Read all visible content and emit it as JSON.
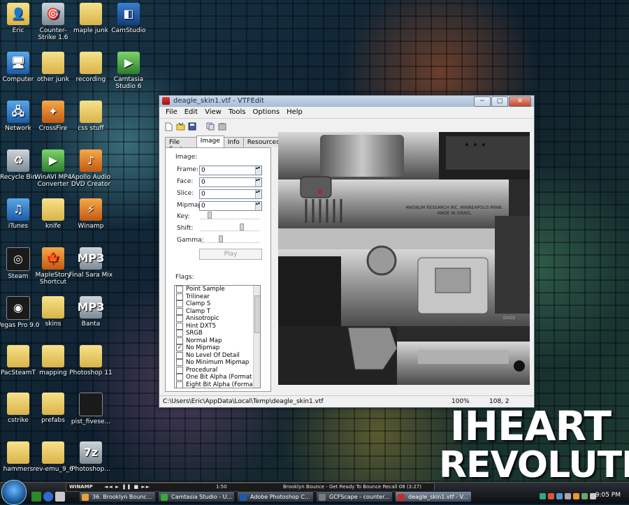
{
  "desktop": {
    "icons": [
      {
        "label": "Eric",
        "glyph": "👤",
        "style": "folder"
      },
      {
        "label": "Counter-Strike 1.6",
        "glyph": "🎯",
        "style": "grey"
      },
      {
        "label": "maple junk",
        "glyph": "",
        "style": "folder"
      },
      {
        "label": "CamStudio",
        "glyph": "◧",
        "style": "teal"
      },
      {
        "label": "Computer",
        "glyph": "🖥",
        "style": "blue"
      },
      {
        "label": "other junk",
        "glyph": "",
        "style": "folder"
      },
      {
        "label": "recording",
        "glyph": "",
        "style": "folder"
      },
      {
        "label": "Camtasia Studio 6",
        "glyph": "▶",
        "style": "green"
      },
      {
        "label": "Network",
        "glyph": "🖧",
        "style": "blue"
      },
      {
        "label": "CrossFire",
        "glyph": "✦",
        "style": "orange"
      },
      {
        "label": "css stuff",
        "glyph": "",
        "style": "folder"
      },
      {
        "label": "Recycle Bin",
        "glyph": "♻",
        "style": "grey"
      },
      {
        "label": "WinAVI MP4 Converter",
        "glyph": "▶",
        "style": "green"
      },
      {
        "label": "Apollo Audio DVD Creator",
        "glyph": "♪",
        "style": "orange"
      },
      {
        "label": "iTunes",
        "glyph": "♫",
        "style": "blue"
      },
      {
        "label": "knife",
        "glyph": "",
        "style": "folder"
      },
      {
        "label": "Winamp",
        "glyph": "⚡",
        "style": "orange"
      },
      {
        "label": "Steam",
        "glyph": "◎",
        "style": "dark"
      },
      {
        "label": "MapleStory Shortcut",
        "glyph": "🍁",
        "style": "orange"
      },
      {
        "label": "Final Sara Mix",
        "glyph": "MP3",
        "style": "grey"
      },
      {
        "label": "Vegas Pro 9.0",
        "glyph": "◉",
        "style": "dark"
      },
      {
        "label": "skins",
        "glyph": "",
        "style": "folder"
      },
      {
        "label": "Banta",
        "glyph": "MP3",
        "style": "grey"
      },
      {
        "label": "PacSteamT",
        "glyph": "",
        "style": "folder"
      },
      {
        "label": "mapping",
        "glyph": "",
        "style": "folder"
      },
      {
        "label": "Photoshop 11",
        "glyph": "",
        "style": "folder"
      },
      {
        "label": "cstrike",
        "glyph": "",
        "style": "folder"
      },
      {
        "label": "prefabs",
        "glyph": "",
        "style": "folder"
      },
      {
        "label": "pist_fivese...",
        "glyph": "",
        "style": "dark"
      },
      {
        "label": "hammers",
        "glyph": "",
        "style": "folder"
      },
      {
        "label": "rev-emu_9_6",
        "glyph": "",
        "style": "folder"
      },
      {
        "label": "Photoshop...",
        "glyph": "7z",
        "style": "grey"
      }
    ],
    "wallpaper_text": [
      "IHEART",
      "REVOLUTION"
    ]
  },
  "window": {
    "title": "deagle_skin1.vtf - VTFEdit",
    "buttons": {
      "minimize": "─",
      "maximize": "□",
      "close": "✕"
    },
    "menu": [
      "File",
      "Edit",
      "View",
      "Tools",
      "Options",
      "Help"
    ],
    "toolbar_icons": [
      "new-icon",
      "open-icon",
      "save-icon",
      "copy-icon",
      "paste-icon"
    ],
    "tabs": [
      "File System",
      "Image",
      "Info",
      "Resources"
    ],
    "active_tab": "Image",
    "image_group": "Image:",
    "fields": {
      "frame": {
        "label": "Frame:",
        "value": "0"
      },
      "face": {
        "label": "Face:",
        "value": "0"
      },
      "slice": {
        "label": "Slice:",
        "value": "0"
      },
      "mipmap": {
        "label": "Mipmap:",
        "value": "0"
      }
    },
    "sliders": {
      "key": "Key:",
      "shift": "Shift:",
      "gamma": "Gamma:"
    },
    "play_label": "Play",
    "flags_group": "Flags:",
    "flags": [
      {
        "label": "Point Sample",
        "checked": false
      },
      {
        "label": "Trilinear",
        "checked": false
      },
      {
        "label": "Clamp S",
        "checked": false
      },
      {
        "label": "Clamp T",
        "checked": false
      },
      {
        "label": "Anisotropic",
        "checked": false
      },
      {
        "label": "Hint DXT5",
        "checked": false
      },
      {
        "label": "SRGB",
        "checked": false
      },
      {
        "label": "Normal Map",
        "checked": false
      },
      {
        "label": "No Mipmap",
        "checked": true
      },
      {
        "label": "No Level Of Detail",
        "checked": false
      },
      {
        "label": "No Minimum Mipmap",
        "checked": false
      },
      {
        "label": "Procedural",
        "checked": false
      },
      {
        "label": "One Bit Alpha (Format Spec",
        "checked": false
      },
      {
        "label": "Eight Bit Alpha (Format Spe",
        "checked": false
      }
    ],
    "texture_text": {
      "line1": "MAGNUM RESEARCH INC. MINNEAPOLIS MINN.",
      "line2": "MADE IN ISRAEL",
      "side": "DVGS"
    },
    "status": {
      "path": "C:\\Users\\Eric\\AppData\\Local\\Temp\\deagle_skin1.vtf",
      "zoom": "100%",
      "coords": "108, 2"
    }
  },
  "taskbar": {
    "winamp_label": "WINAMP",
    "winamp_time": "1:50",
    "winamp_track": "Brooklyn Bounce - Get Ready To Bounce Recall 08 (3:27)",
    "tasks": [
      {
        "label": "36. Brooklyn Bounc...",
        "color": "#f0a030"
      },
      {
        "label": "Camtasia Studio - U...",
        "color": "#39a839"
      },
      {
        "label": "Adobe Photoshop C...",
        "color": "#1c5aa8"
      },
      {
        "label": "GCFScape - counter...",
        "color": "#7a7a7a"
      },
      {
        "label": "deagle_skin1.vtf - V...",
        "color": "#c0302a"
      }
    ],
    "clock": "9:05 PM"
  }
}
